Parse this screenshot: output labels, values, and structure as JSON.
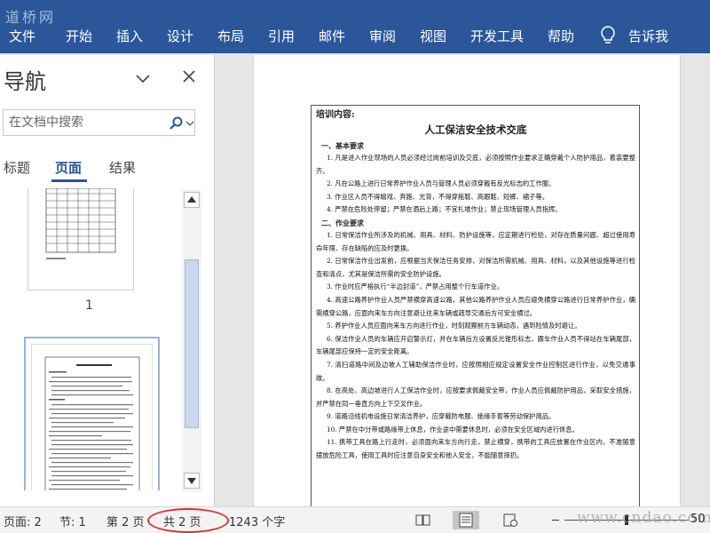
{
  "watermark": {
    "top_left": "道桥网",
    "bottom_right": "www.cndao.com"
  },
  "ribbon": {
    "tabs": [
      {
        "label": "文件"
      },
      {
        "label": "开始"
      },
      {
        "label": "插入"
      },
      {
        "label": "设计"
      },
      {
        "label": "布局"
      },
      {
        "label": "引用"
      },
      {
        "label": "邮件"
      },
      {
        "label": "审阅"
      },
      {
        "label": "视图"
      },
      {
        "label": "开发工具"
      },
      {
        "label": "帮助"
      }
    ],
    "tell_me": "告诉我",
    "icons": {
      "tell_me": "lightbulb-icon"
    }
  },
  "nav": {
    "title": "导航",
    "search_placeholder": "在文档中搜索",
    "tabs": [
      {
        "label": "标题",
        "active": false
      },
      {
        "label": "页面",
        "active": true
      },
      {
        "label": "结果",
        "active": false
      }
    ],
    "page1_number": "1",
    "icons": {
      "options": "chevron-down-icon",
      "close": "close-icon",
      "search": "search-icon"
    }
  },
  "document": {
    "heading": "培训内容:",
    "title": "人工保洁安全技术交底",
    "sections": [
      {
        "heading": "一、基本要求",
        "paragraphs": [
          "1. 凡是进入作业现场的人员必须经过岗前培训及交底，必须按照作业要求正确穿戴个人防护用品，着装要整齐。",
          "2. 凡在公路上进行日常养护作业人员与管理人员必须穿戴有反光标志的工作服。",
          "3. 作业区人员不得嬉戏、奔跑、光背，不得穿拖鞋、高跟鞋、短裤、裙子等。",
          "4. 严禁在危险处停留；严禁在酒后上路；不宜扎堆作业；禁止现场管理人员指挥。"
        ]
      },
      {
        "heading": "二、作业要求",
        "paragraphs": [
          "1. 日常保洁作业所涉及的机械、用具、材料、防护设施等，应定期进行检验，对存在质量问题、超过使用寿命年限、存在缺陷的应及时更换。",
          "2. 日常保洁作业出发前，应根据当天保洁任务安排，对保洁所需机械、用具、材料，以及其他设施等进行检查和清点，尤其是保洁所需的安全防护设施。",
          "3. 作业时应严格执行“半边封道”，严禁占用整个行车道作业。",
          "4. 高速公路养护作业人员严禁横穿高速公路，其他公路养护作业人员应避免横穿公路进行日常养护作业，确需横穿公路，应面向来车方向注意避让往来车辆或疏导交通后方可安全横过。",
          "5. 养护作业人员应面向来车方向进行作业，时刻观察前方车辆动态，遇到险情及时避让。",
          "6. 保洁作业人员的车辆应开启警示灯，并在车辆后方设置反光锥形标志，跟车作业人员不得站在车辆尾部，车辆尾部应保持一定的安全距离。",
          "7. 清扫道路中间及边坡人工辅助保洁作业时，应按照相应规定设置安全作业控制区进行作业，以免交通事故。",
          "8. 在高处、高边坡进行人工保洁作业时，应按要求佩戴安全带，作业人员应佩戴防护用品，采取安全措施，并严禁在同一垂直方向上下交叉作业。",
          "9. 道路沿线机电设施日常清洁养护，应穿戴防电服、绝缘手套等劳动保护用品。",
          "10. 严禁在中分带或路缘带上休息，作业途中需要休息时，必须在安全区域内进行休息。",
          "11. 携带工具在路上行走时，必须面向来车方向行走，禁止横穿，携带的工具应放置在作业区内，不准随意摆放危险工具，使用工具时应注意自身安全和他人安全，不能随意摔扔。"
        ]
      }
    ]
  },
  "status": {
    "page": "页面: 2",
    "section": "节: 1",
    "page_of": "第 2 页",
    "total_pages": "共 2 页",
    "word_count": "1243 个字",
    "zoom": "50"
  },
  "colors": {
    "ribbon": "#2b579a",
    "highlight": "#e03030"
  }
}
